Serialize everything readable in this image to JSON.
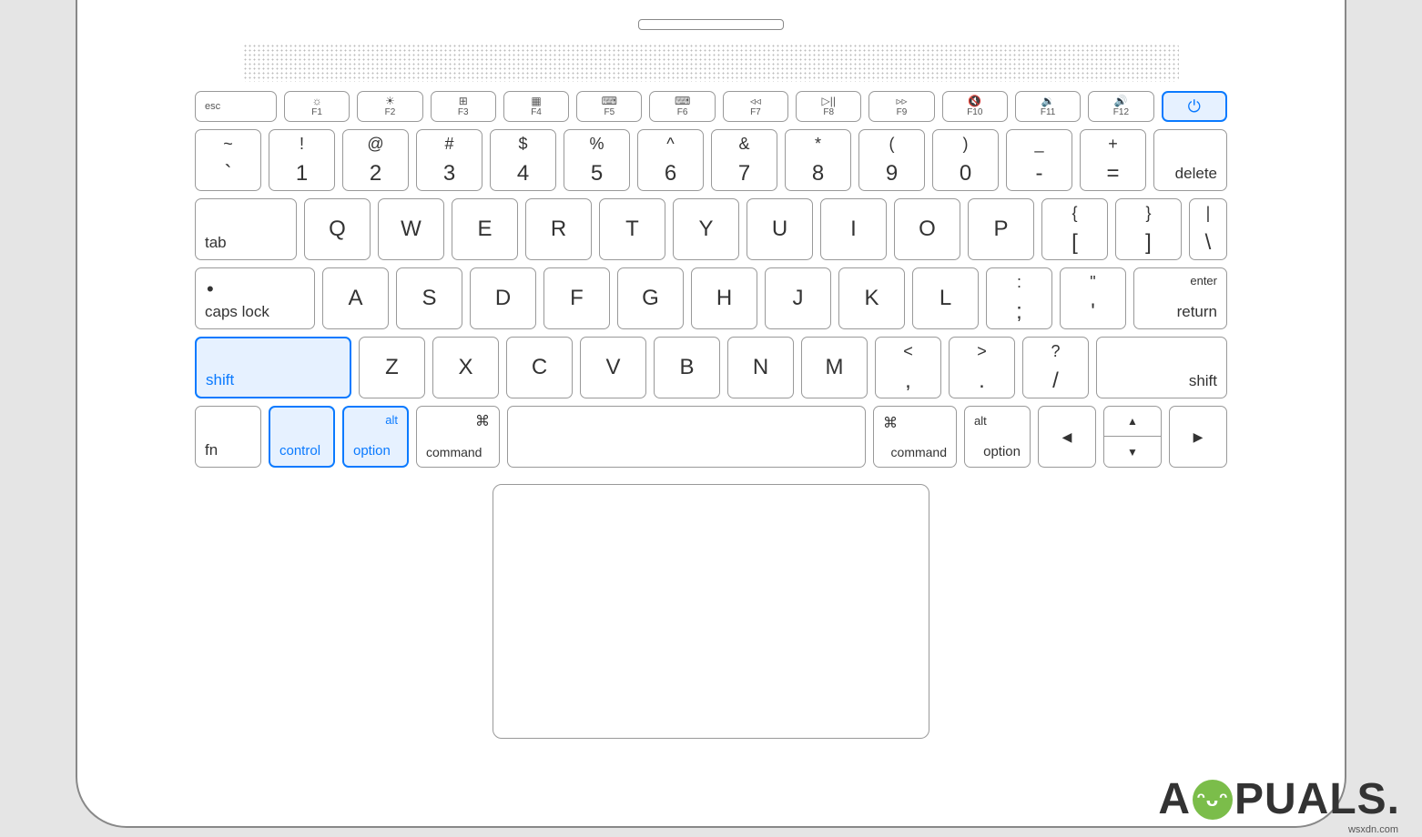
{
  "fn_row": {
    "esc": "esc",
    "keys": [
      {
        "icon": "☼",
        "label": "F1"
      },
      {
        "icon": "☀",
        "label": "F2"
      },
      {
        "icon": "⊞",
        "label": "F3"
      },
      {
        "icon": "▦",
        "label": "F4"
      },
      {
        "icon": "⌨",
        "label": "F5"
      },
      {
        "icon": "⌨",
        "label": "F6"
      },
      {
        "icon": "◃◃",
        "label": "F7"
      },
      {
        "icon": "▷||",
        "label": "F8"
      },
      {
        "icon": "▹▹",
        "label": "F9"
      },
      {
        "icon": "🔇",
        "label": "F10"
      },
      {
        "icon": "🔉",
        "label": "F11"
      },
      {
        "icon": "🔊",
        "label": "F12"
      }
    ],
    "power": "⏻"
  },
  "row1": {
    "keys": [
      {
        "top": "~",
        "bot": "`"
      },
      {
        "top": "!",
        "bot": "1"
      },
      {
        "top": "@",
        "bot": "2"
      },
      {
        "top": "#",
        "bot": "3"
      },
      {
        "top": "$",
        "bot": "4"
      },
      {
        "top": "%",
        "bot": "5"
      },
      {
        "top": "^",
        "bot": "6"
      },
      {
        "top": "&",
        "bot": "7"
      },
      {
        "top": "*",
        "bot": "8"
      },
      {
        "top": "(",
        "bot": "9"
      },
      {
        "top": ")",
        "bot": "0"
      },
      {
        "top": "_",
        "bot": "-"
      },
      {
        "top": "+",
        "bot": "="
      }
    ],
    "delete": "delete"
  },
  "row2": {
    "tab": "tab",
    "letters": [
      "Q",
      "W",
      "E",
      "R",
      "T",
      "Y",
      "U",
      "I",
      "O",
      "P"
    ],
    "bracket_open": {
      "top": "{",
      "bot": "["
    },
    "bracket_close": {
      "top": "}",
      "bot": "]"
    },
    "backslash": {
      "top": "|",
      "bot": "\\"
    }
  },
  "row3": {
    "caps": "caps lock",
    "letters": [
      "A",
      "S",
      "D",
      "F",
      "G",
      "H",
      "J",
      "K",
      "L"
    ],
    "semi": {
      "top": ":",
      "bot": ";"
    },
    "quote": {
      "top": "\"",
      "bot": "'"
    },
    "enter_top": "enter",
    "enter_bot": "return"
  },
  "row4": {
    "lshift": "shift",
    "letters": [
      "Z",
      "X",
      "C",
      "V",
      "B",
      "N",
      "M"
    ],
    "comma": {
      "top": "<",
      "bot": ","
    },
    "period": {
      "top": ">",
      "bot": "."
    },
    "slash": {
      "top": "?",
      "bot": "/"
    },
    "rshift": "shift"
  },
  "row5": {
    "fn": "fn",
    "control": "control",
    "option": "option",
    "alt": "alt",
    "command": "command",
    "cmd_icon": "⌘",
    "arrows": {
      "up": "▲",
      "down": "▼",
      "left": "◀",
      "right": "▶"
    }
  },
  "watermark": {
    "brand_prefix": "A",
    "brand_suffix": "PUALS.",
    "url": "wsxdn.com"
  }
}
